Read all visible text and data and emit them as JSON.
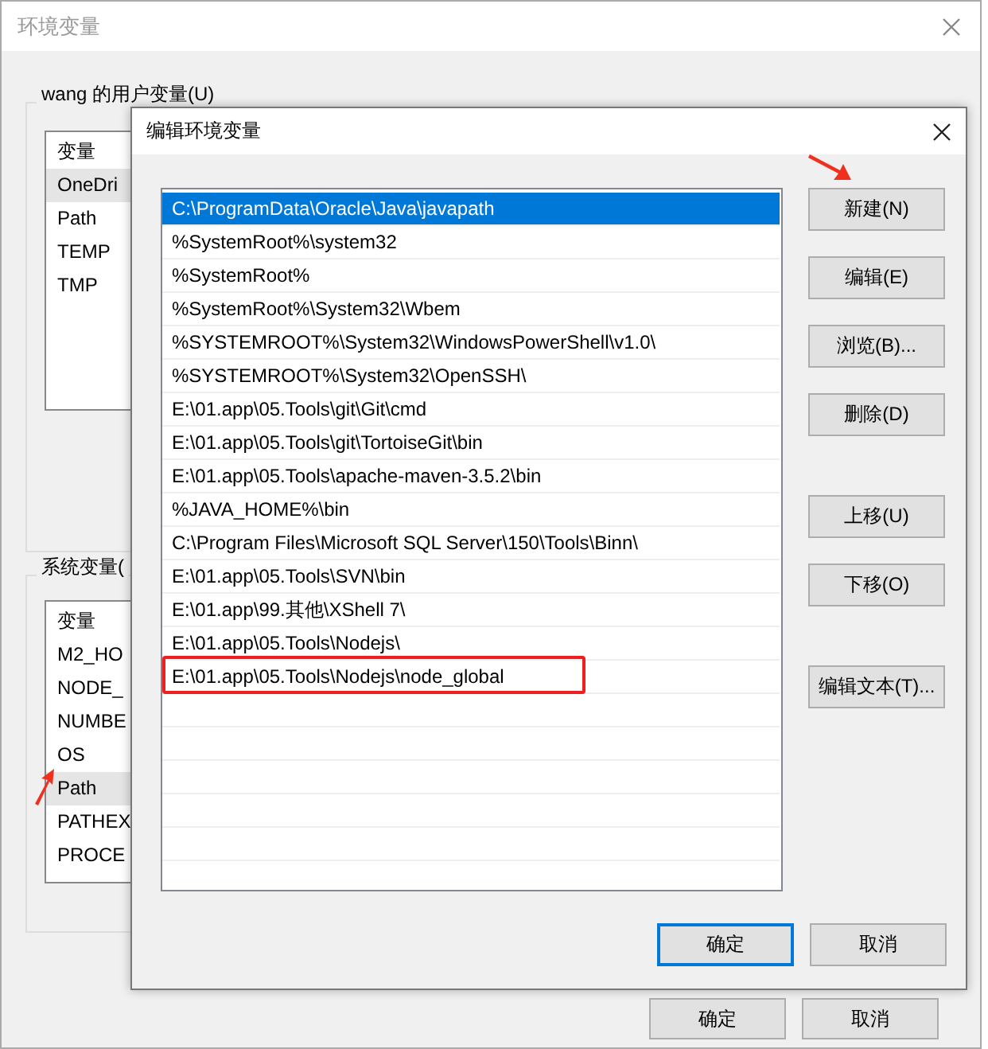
{
  "window": {
    "title": "环境变量"
  },
  "user_vars": {
    "label": "wang 的用户变量(U)",
    "column": "变量",
    "items": [
      {
        "name": "OneDri",
        "selected": true
      },
      {
        "name": "Path",
        "selected": false
      },
      {
        "name": "TEMP",
        "selected": false
      },
      {
        "name": "TMP",
        "selected": false
      }
    ]
  },
  "system_vars": {
    "label": "系统变量(",
    "column": "变量",
    "items": [
      {
        "name": "M2_HO",
        "selected": false
      },
      {
        "name": "NODE_",
        "selected": false
      },
      {
        "name": "NUMBE",
        "selected": false
      },
      {
        "name": "OS",
        "selected": false
      },
      {
        "name": "Path",
        "selected": true
      },
      {
        "name": "PATHEX",
        "selected": false
      },
      {
        "name": "PROCE",
        "selected": false
      }
    ]
  },
  "window_buttons": [
    "确定",
    "取消"
  ],
  "dialog": {
    "title": "编辑环境变量",
    "paths": [
      {
        "text": "C:\\ProgramData\\Oracle\\Java\\javapath",
        "selected": true,
        "annotated": false
      },
      {
        "text": "%SystemRoot%\\system32",
        "selected": false,
        "annotated": false
      },
      {
        "text": "%SystemRoot%",
        "selected": false,
        "annotated": false
      },
      {
        "text": "%SystemRoot%\\System32\\Wbem",
        "selected": false,
        "annotated": false
      },
      {
        "text": "%SYSTEMROOT%\\System32\\WindowsPowerShell\\v1.0\\",
        "selected": false,
        "annotated": false
      },
      {
        "text": "%SYSTEMROOT%\\System32\\OpenSSH\\",
        "selected": false,
        "annotated": false
      },
      {
        "text": "E:\\01.app\\05.Tools\\git\\Git\\cmd",
        "selected": false,
        "annotated": false
      },
      {
        "text": "E:\\01.app\\05.Tools\\git\\TortoiseGit\\bin",
        "selected": false,
        "annotated": false
      },
      {
        "text": "E:\\01.app\\05.Tools\\apache-maven-3.5.2\\bin",
        "selected": false,
        "annotated": false
      },
      {
        "text": "%JAVA_HOME%\\bin",
        "selected": false,
        "annotated": false
      },
      {
        "text": "C:\\Program Files\\Microsoft SQL Server\\150\\Tools\\Binn\\",
        "selected": false,
        "annotated": false
      },
      {
        "text": "E:\\01.app\\05.Tools\\SVN\\bin",
        "selected": false,
        "annotated": false
      },
      {
        "text": "E:\\01.app\\99.其他\\XShell 7\\",
        "selected": false,
        "annotated": false
      },
      {
        "text": "E:\\01.app\\05.Tools\\Nodejs\\",
        "selected": false,
        "annotated": false
      },
      {
        "text": "E:\\01.app\\05.Tools\\Nodejs\\node_global",
        "selected": false,
        "annotated": true
      }
    ],
    "side_button_groups": [
      [
        "新建(N)",
        "编辑(E)",
        "浏览(B)...",
        "删除(D)"
      ],
      [
        "上移(U)",
        "下移(O)"
      ],
      [
        "编辑文本(T)..."
      ]
    ],
    "buttons": [
      {
        "label": "确定",
        "default": true
      },
      {
        "label": "取消",
        "default": false
      }
    ]
  }
}
